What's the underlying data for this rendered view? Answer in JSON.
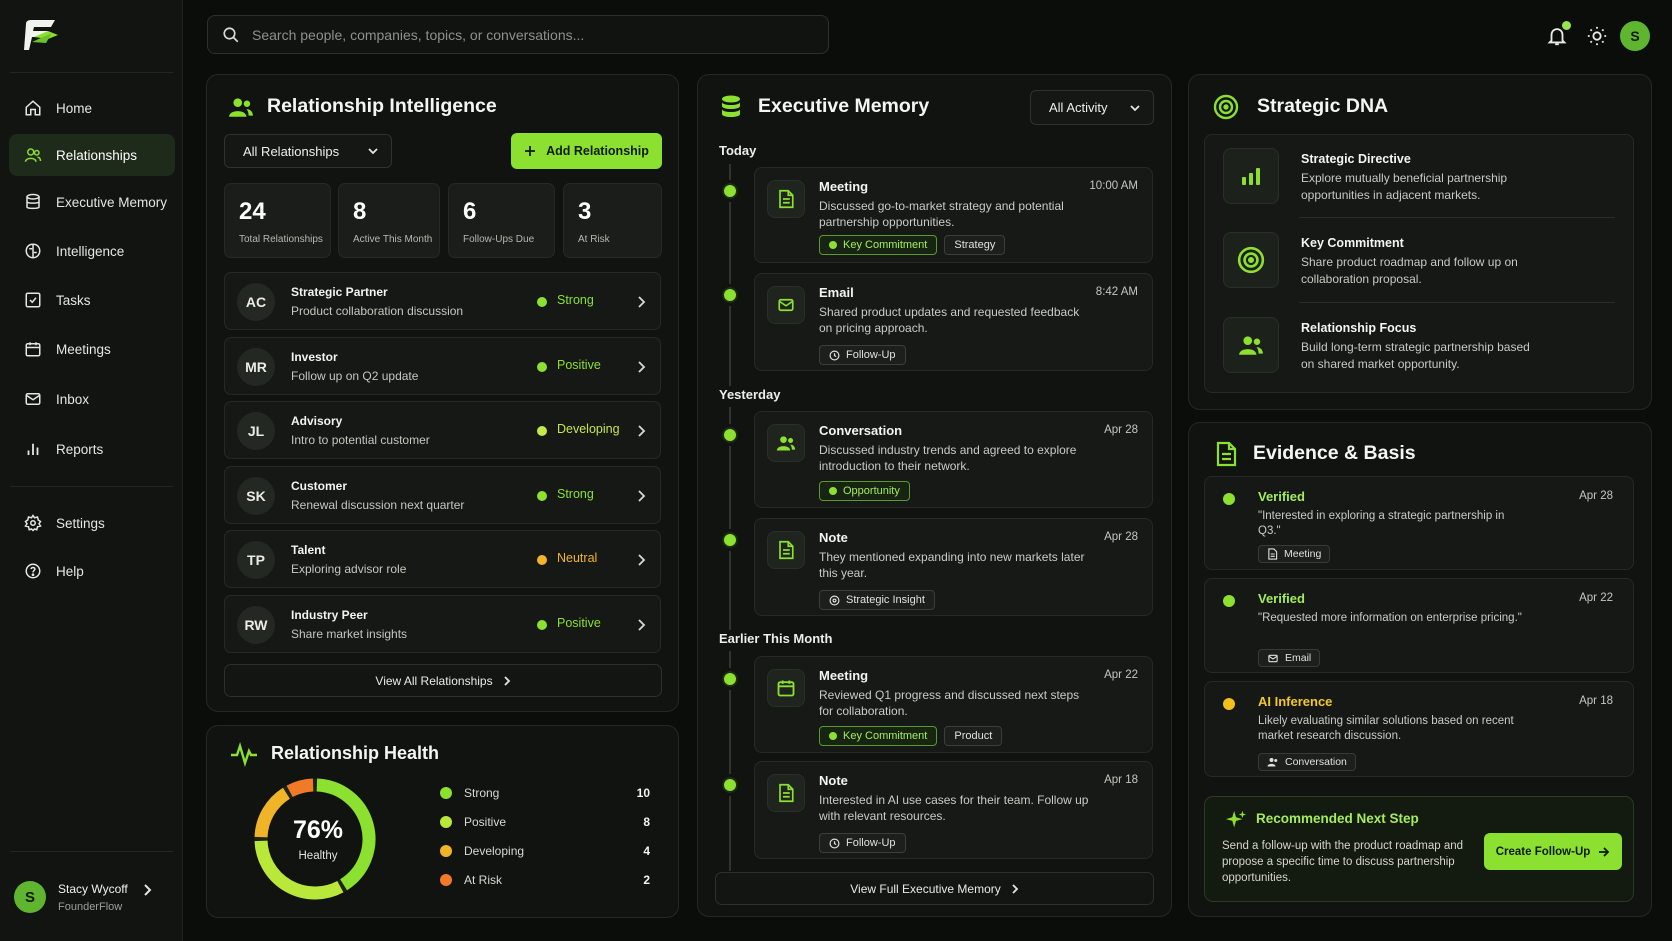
{
  "app": {
    "user_initial": "S"
  },
  "search": {
    "placeholder": "Search people, companies, topics, or conversations..."
  },
  "sidebar": {
    "items": [
      {
        "label": "Home",
        "icon": "home-icon"
      },
      {
        "label": "Relationships",
        "icon": "users-icon",
        "active": true
      },
      {
        "label": "Executive Memory",
        "icon": "database-icon"
      },
      {
        "label": "Intelligence",
        "icon": "brain-icon"
      },
      {
        "label": "Tasks",
        "icon": "checkbox-icon"
      },
      {
        "label": "Meetings",
        "icon": "calendar-icon"
      },
      {
        "label": "Inbox",
        "icon": "mail-icon"
      },
      {
        "label": "Reports",
        "icon": "bar-chart-icon"
      },
      {
        "label": "Settings",
        "icon": "gear-icon"
      },
      {
        "label": "Help",
        "icon": "help-icon"
      }
    ],
    "profile": {
      "initial": "S",
      "name": "Stacy Wycoff",
      "org": "FounderFlow"
    }
  },
  "relationships": {
    "title": "Relationship Intelligence",
    "filter": "All Relationships",
    "add_label": "Add Relationship",
    "stats": [
      {
        "value": "24",
        "label": "Total Relationships"
      },
      {
        "value": "8",
        "label": "Active This Month"
      },
      {
        "value": "6",
        "label": "Follow-Ups Due"
      },
      {
        "value": "3",
        "label": "At Risk"
      }
    ],
    "rows": [
      {
        "initials": "AC",
        "name": "Strategic Partner",
        "sub": "Product collaboration discussion",
        "status": "Strong",
        "color": "#8ce02f"
      },
      {
        "initials": "MR",
        "name": "Investor",
        "sub": "Follow up on Q2 update",
        "status": "Positive",
        "color": "#8ce02f"
      },
      {
        "initials": "JL",
        "name": "Advisory",
        "sub": "Intro to potential customer",
        "status": "Developing",
        "color": "#c5e84a"
      },
      {
        "initials": "SK",
        "name": "Customer",
        "sub": "Renewal discussion next quarter",
        "status": "Strong",
        "color": "#8ce02f"
      },
      {
        "initials": "TP",
        "name": "Talent",
        "sub": "Exploring advisor role",
        "status": "Neutral",
        "color": "#f3b428"
      },
      {
        "initials": "RW",
        "name": "Industry Peer",
        "sub": "Share market insights",
        "status": "Positive",
        "color": "#8ce02f"
      }
    ],
    "view_all": "View All Relationships"
  },
  "health": {
    "title": "Relationship Health",
    "percent": "76%",
    "label": "Healthy",
    "legend": [
      {
        "label": "Strong",
        "value": "10",
        "color": "#8ce02f"
      },
      {
        "label": "Positive",
        "value": "8",
        "color": "#b9e83a"
      },
      {
        "label": "Developing",
        "value": "4",
        "color": "#f0b429"
      },
      {
        "label": "At Risk",
        "value": "2",
        "color": "#f07a28"
      }
    ]
  },
  "memory": {
    "title": "Executive Memory",
    "filter": "All Activity",
    "sections": [
      "Today",
      "Yesterday",
      "Earlier This Month"
    ],
    "entries": [
      {
        "type": "Meeting",
        "time": "10:00 AM",
        "desc": "Discussed go-to-market strategy and potential partnership opportunities.",
        "tags": [
          "Key Commitment",
          "Strategy"
        ],
        "icon": "document-icon"
      },
      {
        "type": "Email",
        "time": "8:42 AM",
        "desc": "Shared product updates and requested feedback on pricing approach.",
        "tags": [
          "Follow-Up"
        ],
        "icon": "mail-icon"
      },
      {
        "type": "Conversation",
        "time": "Apr 28",
        "desc": "Discussed industry trends and agreed to explore introduction to their network.",
        "tags": [
          "Opportunity"
        ],
        "icon": "users-icon"
      },
      {
        "type": "Note",
        "time": "Apr 28",
        "desc": "They mentioned expanding into new markets later this year.",
        "tags": [
          "Strategic Insight"
        ],
        "icon": "document-icon"
      },
      {
        "type": "Meeting",
        "time": "Apr 22",
        "desc": "Reviewed Q1 progress and discussed next steps for collaboration.",
        "tags": [
          "Key Commitment",
          "Product"
        ],
        "icon": "calendar-icon"
      },
      {
        "type": "Note",
        "time": "Apr 18",
        "desc": "Interested in AI use cases for their team. Follow up with relevant resources.",
        "tags": [
          "Follow-Up"
        ],
        "icon": "document-icon"
      }
    ],
    "view_all": "View Full Executive Memory"
  },
  "dna": {
    "title": "Strategic DNA",
    "items": [
      {
        "title": "Strategic Directive",
        "desc": "Explore mutually beneficial partnership opportunities in adjacent markets.",
        "icon": "bar-chart-icon"
      },
      {
        "title": "Key Commitment",
        "desc": "Share product roadmap and follow up on collaboration proposal.",
        "icon": "target-icon"
      },
      {
        "title": "Relationship Focus",
        "desc": "Build long-term strategic partnership based on shared market opportunity.",
        "icon": "users-icon"
      }
    ]
  },
  "evidence": {
    "title": "Evidence & Basis",
    "items": [
      {
        "title": "Verified",
        "date": "Apr 28",
        "quote": "\"Interested in exploring a strategic partnership in Q3.\"",
        "source": "Meeting",
        "color": "#8ce02f"
      },
      {
        "title": "Verified",
        "date": "Apr 22",
        "quote": "\"Requested more information on enterprise pricing.\"",
        "source": "Email",
        "color": "#8ce02f"
      },
      {
        "title": "AI Inference",
        "date": "Apr 18",
        "quote": "Likely evaluating similar solutions based on recent market research discussion.",
        "source": "Conversation",
        "color": "#f0c21a"
      }
    ],
    "next_step": {
      "title": "Recommended Next Step",
      "desc": "Send a follow-up with the product roadmap and propose a specific time to discuss partnership opportunities.",
      "button": "Create Follow-Up"
    }
  },
  "colors": {
    "accent": "#8ce02f",
    "background": "#0b0d0b",
    "panel": "#111311",
    "warning": "#f0b429",
    "risk": "#f07a28"
  }
}
